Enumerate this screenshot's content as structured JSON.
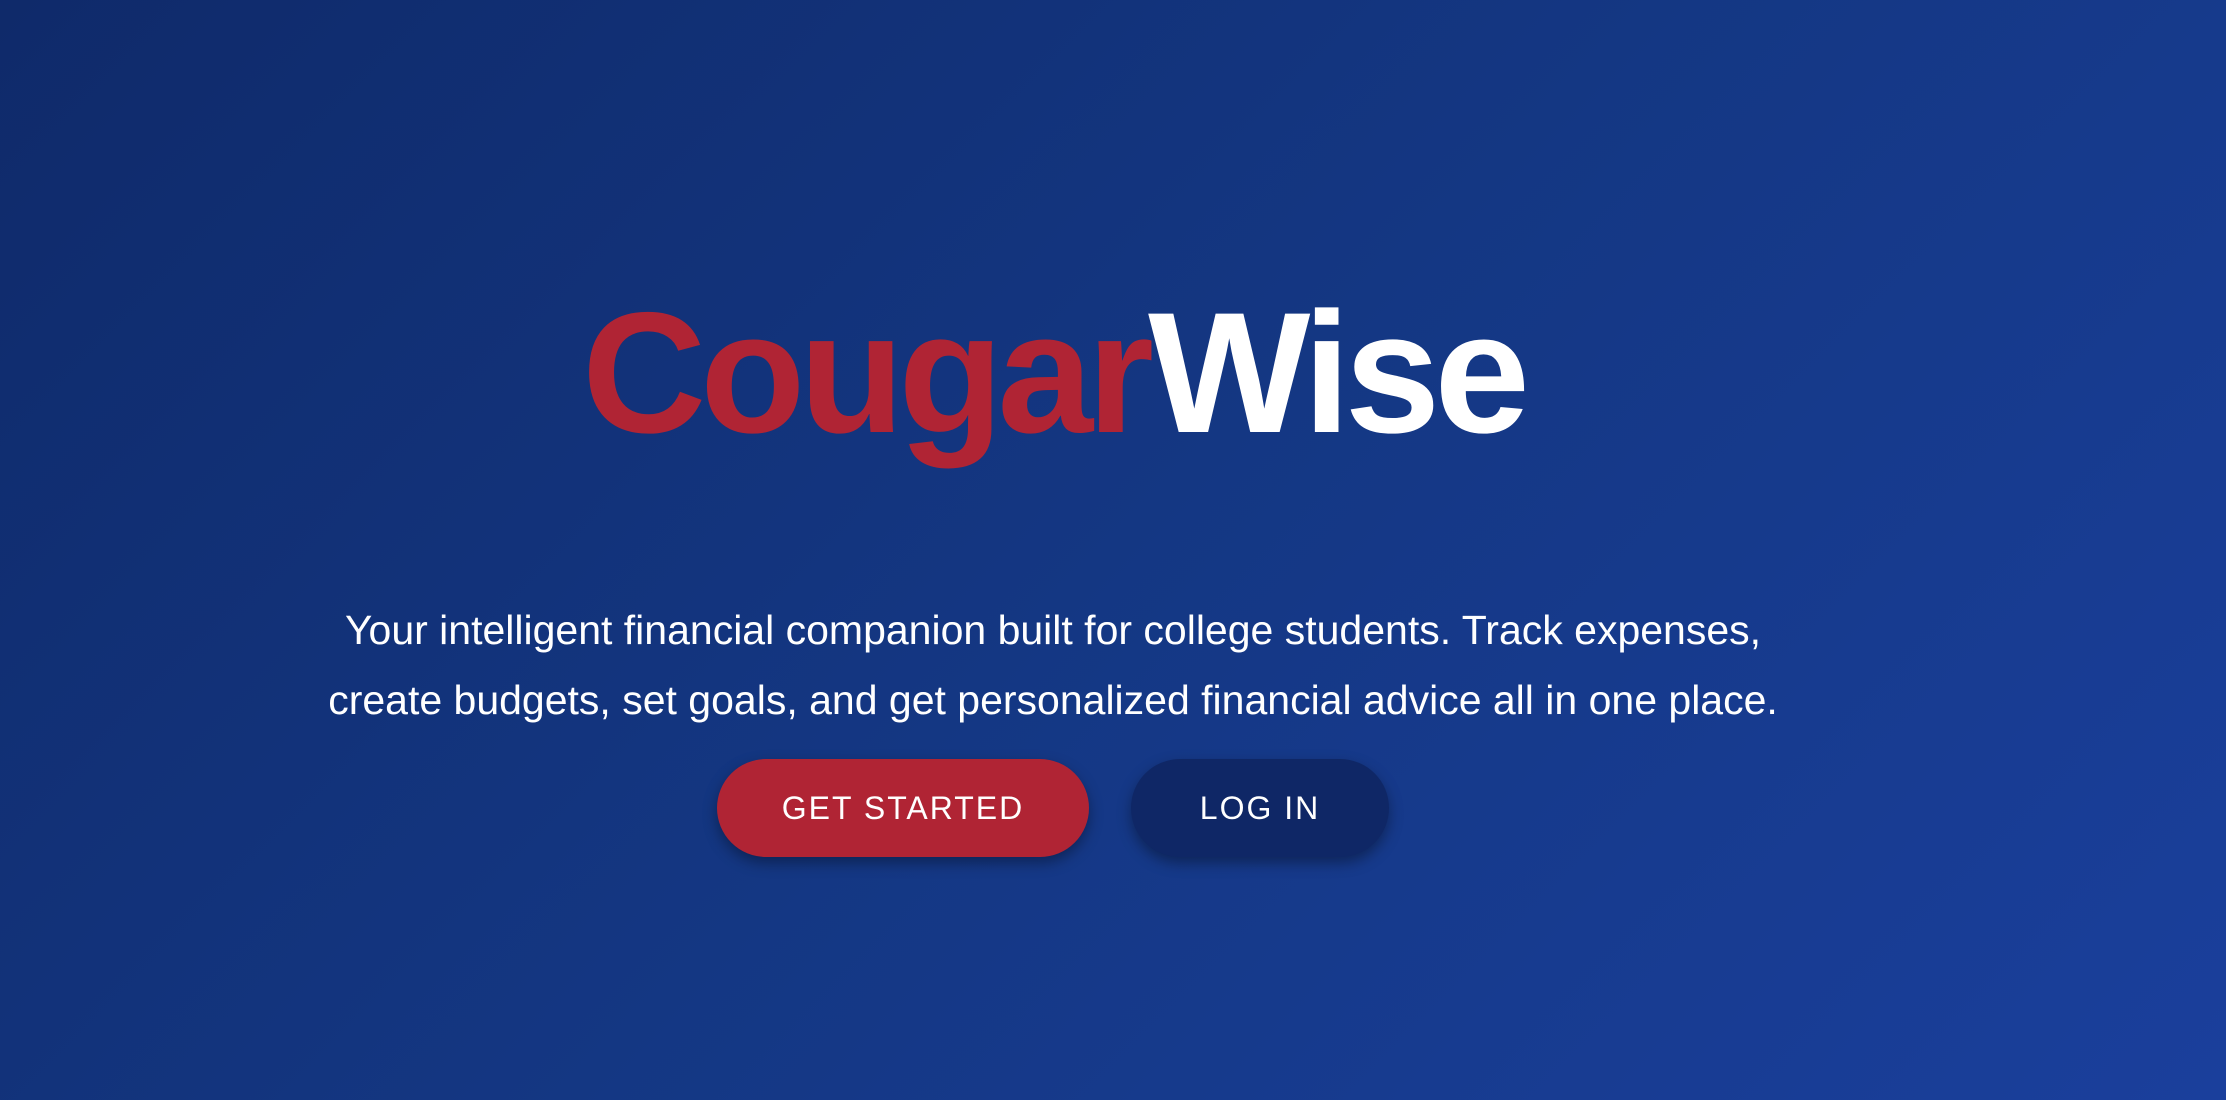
{
  "hero": {
    "logo": {
      "part1": "Cougar",
      "part2": "Wise"
    },
    "tagline": "Your intelligent financial companion built for college students. Track expenses, create budgets, set goals, and get personalized financial advice all in one place.",
    "buttons": {
      "get_started": "GET STARTED",
      "log_in": "LOG IN"
    }
  },
  "colors": {
    "brand_red": "#b02434",
    "background_start": "#0f2a6a",
    "background_end": "#1a3f9c",
    "secondary_button": "#0f2766",
    "text": "#ffffff"
  }
}
